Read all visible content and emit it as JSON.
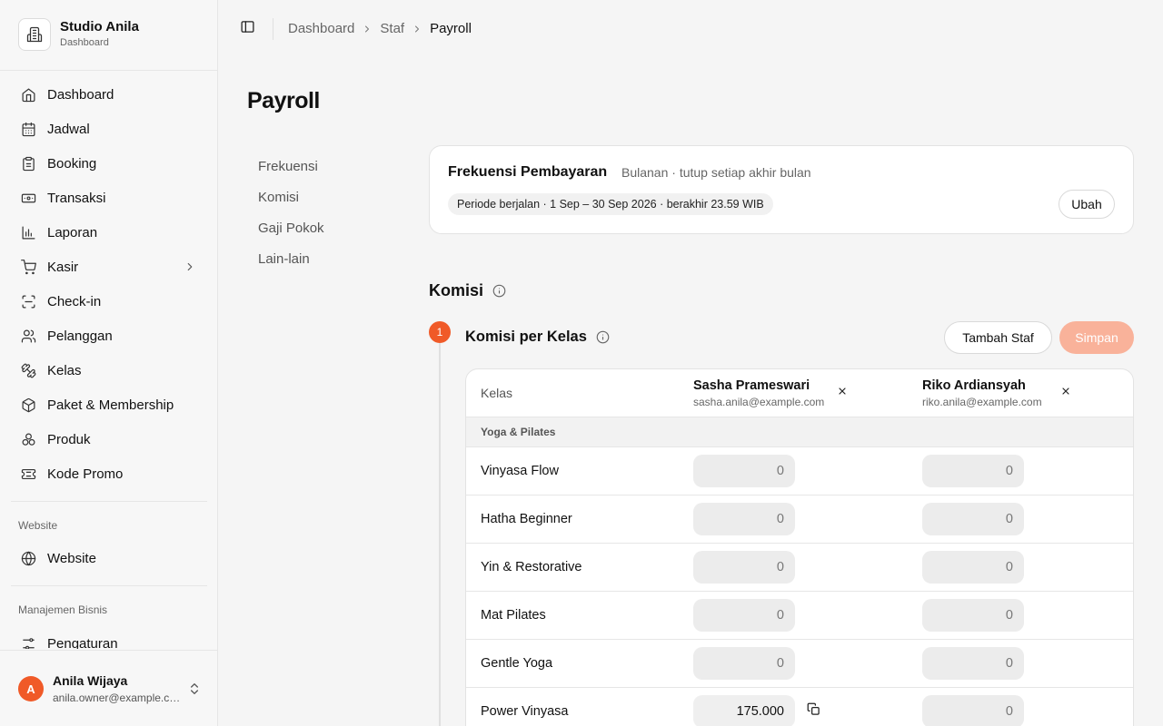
{
  "sidebar": {
    "brand_name": "Studio Anila",
    "brand_sub": "Dashboard",
    "items": [
      {
        "label": "Dashboard",
        "icon": "home-icon"
      },
      {
        "label": "Jadwal",
        "icon": "calendar-icon"
      },
      {
        "label": "Booking",
        "icon": "clipboard-icon"
      },
      {
        "label": "Transaksi",
        "icon": "banknote-icon"
      },
      {
        "label": "Laporan",
        "icon": "bar-chart-icon"
      },
      {
        "label": "Kasir",
        "icon": "cart-icon"
      },
      {
        "label": "Check-in",
        "icon": "scan-icon"
      },
      {
        "label": "Pelanggan",
        "icon": "users-icon"
      },
      {
        "label": "Kelas",
        "icon": "dumbbell-icon"
      },
      {
        "label": "Paket & Membership",
        "icon": "package-icon"
      },
      {
        "label": "Produk",
        "icon": "boxes-icon"
      },
      {
        "label": "Kode Promo",
        "icon": "ticket-icon"
      }
    ],
    "website_section": "Website",
    "website_item": "Website",
    "business_section": "Manajemen Bisnis",
    "business_item": "Pengaturan",
    "user": {
      "initial": "A",
      "name": "Anila Wijaya",
      "email": "anila.owner@example.com"
    }
  },
  "breadcrumb": [
    "Dashboard",
    "Staf",
    "Payroll"
  ],
  "page_title": "Payroll",
  "subnav": [
    "Frekuensi",
    "Komisi",
    "Gaji Pokok",
    "Lain-lain"
  ],
  "frequency": {
    "title": "Frekuensi Pembayaran",
    "description": "Bulanan · tutup setiap akhir bulan",
    "period": "Periode berjalan · 1 Sep – 30 Sep 2026 · berakhir 23.59 WIB",
    "change_label": "Ubah"
  },
  "komisi": {
    "title": "Komisi",
    "step_number": "1",
    "step_title": "Komisi per Kelas",
    "add_staff_label": "Tambah Staf",
    "save_label": "Simpan"
  },
  "table": {
    "class_header": "Kelas",
    "staff": [
      {
        "name": "Sasha Prameswari",
        "email": "sasha.anila@example.com"
      },
      {
        "name": "Riko Ardiansyah",
        "email": "riko.anila@example.com"
      }
    ],
    "group": "Yoga & Pilates",
    "rows": [
      {
        "label": "Vinyasa Flow",
        "values": [
          "0",
          "0"
        ]
      },
      {
        "label": "Hatha Beginner",
        "values": [
          "0",
          "0"
        ]
      },
      {
        "label": "Yin & Restorative",
        "values": [
          "0",
          "0"
        ]
      },
      {
        "label": "Mat Pilates",
        "values": [
          "0",
          "0"
        ]
      },
      {
        "label": "Gentle Yoga",
        "values": [
          "0",
          "0"
        ]
      },
      {
        "label": "Power Vinyasa",
        "values": [
          "175.000",
          "0"
        ]
      }
    ]
  },
  "colors": {
    "accent": "#f05a28",
    "accent_disabled": "#f9b29a"
  }
}
